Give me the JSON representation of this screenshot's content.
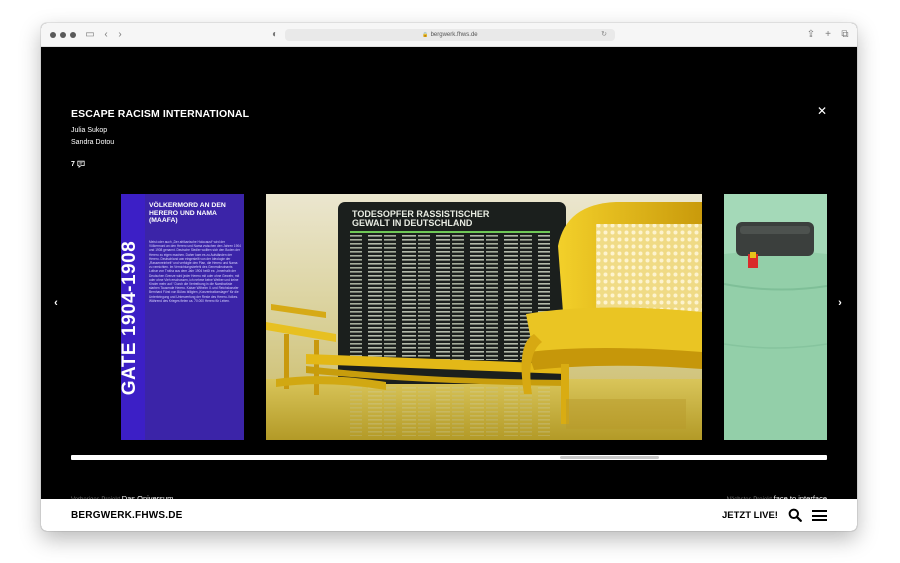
{
  "browser": {
    "url": "bergwerk.fhws.de"
  },
  "project": {
    "title": "ESCAPE RACISM INTERNATIONAL",
    "authors": [
      "Julia Sukop",
      "Sandra Dotou"
    ],
    "comment_count": "7"
  },
  "gallery": {
    "poster": {
      "vertical_title": "GATE 1904-1908",
      "heading": "VÖLKERMORD AN DEN HERERO UND NAMA (MAAFA)",
      "body": "Meist oder auch „Der afrikanische Holocaust“ wird der Völkermord an den Herero und Nama zwischen den Jahren 1904 und 1908 genannt. Deutsche Siedler wollten sich den Boden der Herero zu eigen machen. Daher kam es zu Aufständen der Herero. Deutschland war eingestellt von der Ideologie der „Rassenreinheit“ und verfolgte den Plan, die Herero und Nama zu vernichten. Im Vernichtungsbefehl des Generalleutnants Lothar von Trotha aus dem Jahr 1904 heißt es: „Innerhalb der Deutschen Grenze wird jeder Herero mit oder ohne Gewehr, mit oder ohne Vieh erschossen, ich nehme keine Weiber und keine Kinder mehr auf.“ Durch die Vertreibung in die Namibwüste starben Tausende Herero. Kaiser Wilhelm II. und Reichskanzler Bernhard Fürst von Bülow billigten „Konzentrationslager“ für die Unterbringung und Unterwerfung der Reste des Herero-Volkes. Während des Krieges fielen ca. 70.000 Herero für Leben."
    },
    "main_slide": {
      "board_title": "TODESOPFER RASSISTISCHER GEWALT IN DEUTSCHLAND"
    }
  },
  "navigation": {
    "prev_label": "Vorheriges Projekt",
    "prev_title": "Das Oniversum",
    "next_label": "Nächstes Projekt",
    "next_title": "face to interface"
  },
  "footer": {
    "brand": "BERGWERK.FHWS.DE",
    "live_label": "JETZT LIVE!"
  },
  "colors": {
    "poster_purple": "#3c1fc6",
    "seat_yellow": "#e3b817",
    "mint": "#9fd6b5"
  }
}
